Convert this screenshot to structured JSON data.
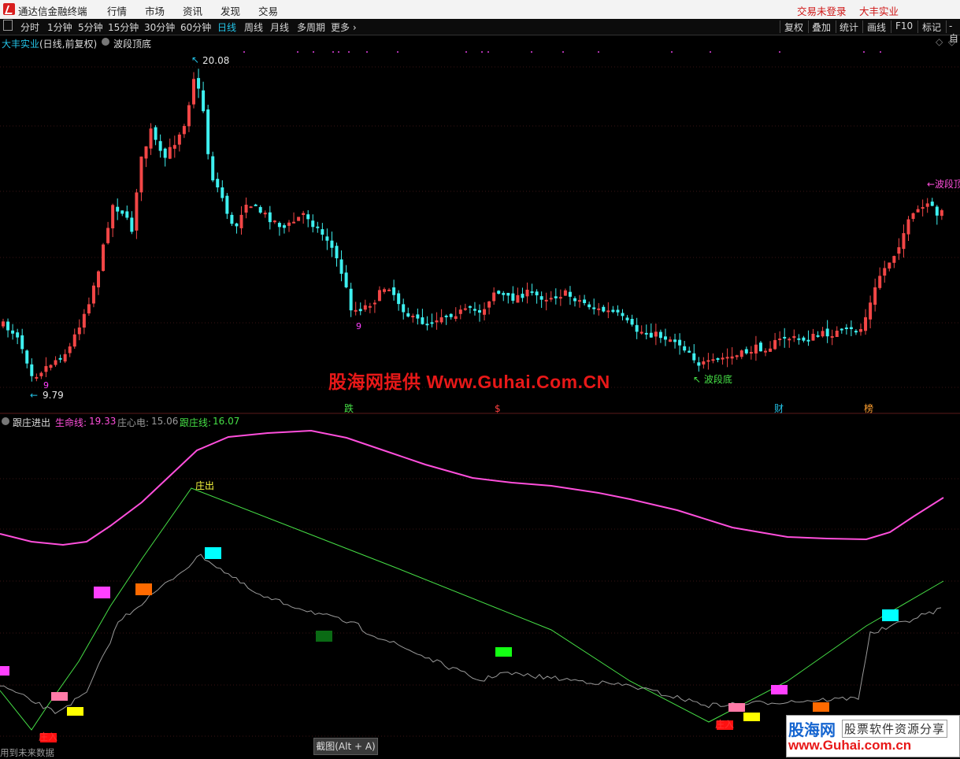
{
  "menubar": {
    "app_title": "通达信金融终端",
    "items": [
      "行情",
      "市场",
      "资讯",
      "发现",
      "交易"
    ],
    "login_status": "交易未登录",
    "stock_name": "大丰实业"
  },
  "toolbar": {
    "periods": [
      "分时",
      "1分钟",
      "5分钟",
      "15分钟",
      "30分钟",
      "60分钟",
      "日线",
      "周线",
      "月线",
      "多周期",
      "更多 ›"
    ],
    "active_period": "日线",
    "right_tools": [
      "复权",
      "叠加",
      "统计",
      "画线",
      "F10",
      "标记",
      "-自"
    ]
  },
  "main_chart": {
    "stock_label": "大丰实业",
    "mode_label": "(日线,前复权)",
    "indicator_name": "波段顶底",
    "high_label": "20.08",
    "low_label": "9.79",
    "low_marker": "9",
    "mid_marker": "9",
    "bottom_signal": "波段底",
    "top_signal": "波段顶",
    "event_markers": [
      "跌",
      "$",
      "财",
      "榜"
    ]
  },
  "sub_chart": {
    "indicator_name": "跟庄进出",
    "life_line_label": "生命线:",
    "life_line_value": "19.33",
    "heart_label": "庄心电:",
    "heart_value": "15.06",
    "follow_label": "跟庄线:",
    "follow_value": "16.07",
    "exit_label": "庄出",
    "entry_label": "庄入",
    "entry_label_2": "庄入"
  },
  "watermark": "股海网提供 Www.Guhai.Com.CN",
  "promo": {
    "line1": "股海网",
    "line1b": "股票软件资源分享",
    "line2": "www.Guhai.com.cn"
  },
  "screenshot_hint": "截图(Alt + A)",
  "footer_note": "用到未来数据",
  "colors": {
    "up": "#f24646",
    "down": "#3ef0f0",
    "life_line": "#ff4fdc",
    "follow_line": "#46e046",
    "heart_line": "#9a9a9a",
    "accent_cyan": "#23c4e8"
  }
}
